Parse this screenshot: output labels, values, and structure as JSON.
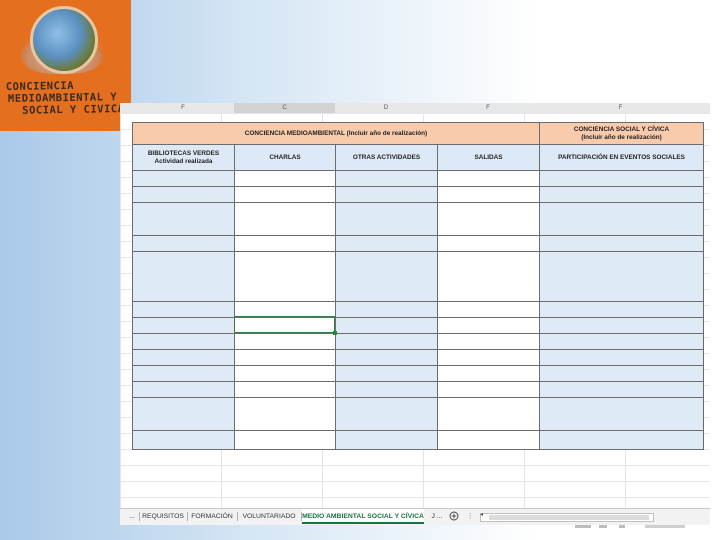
{
  "logo": {
    "lines": [
      "CONCIENCIA",
      "MEDIOAMBIENTAL Y",
      "SOCIAL Y CIVICA"
    ]
  },
  "spreadsheet": {
    "column_letters": [
      "F",
      "C",
      "D",
      "F",
      "F"
    ],
    "headers": {
      "conciencia_medioambiental": "CONCIENCIA MEDIOAMBIENTAL (Incluir año de realización)",
      "conciencia_social_line1": "CONCIENCIA SOCIAL Y CÍVICA",
      "conciencia_social_line2": "(Incluir año de realización)",
      "bibliotecas_line1": "BIBLIOTECAS VERDES",
      "bibliotecas_line2": "Actividad realizada",
      "charlas": "CHARLAS",
      "otras_actividades": "OTRAS ACTIVIDADES",
      "salidas": "SALIDAS",
      "participacion": "PARTICIPACIÓN EN EVENTOS SOCIALES"
    },
    "colors": {
      "header_orange": "#f8cbad",
      "header_blue": "#dde9f6",
      "body_blue": "#deebf7",
      "active_tab_green": "#1e7145"
    }
  },
  "tabs": {
    "prev": "...",
    "items": [
      "REQUISITOS",
      "FORMACIÓN",
      "VOLUNTARIADO",
      "MEDIO AMBIENTAL SOCIAL Y CÍVICA"
    ],
    "active": "MEDIO AMBIENTAL SOCIAL Y CÍVICA",
    "next": "J ...",
    "add_icon": "plus-circle-icon",
    "scroll_left_icon": "scroll-left-icon"
  }
}
